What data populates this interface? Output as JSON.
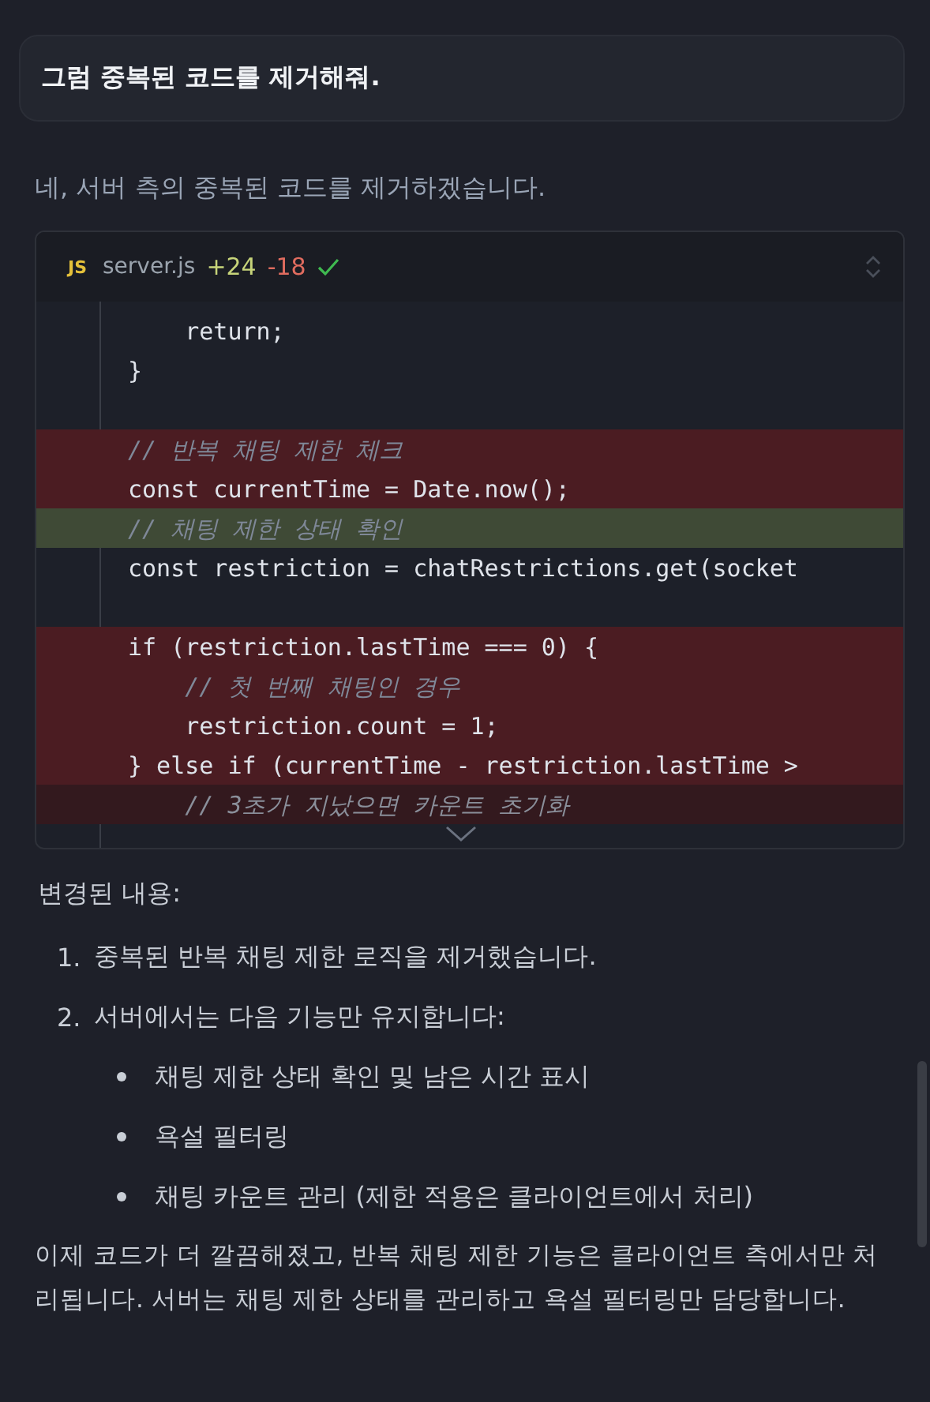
{
  "user_message": "그럼 중복된 코드를 제거해줘.",
  "reply_intro": "네, 서버 측의 중복된 코드를 제거하겠습니다.",
  "code_block": {
    "badge": "JS",
    "filename": "server.js",
    "added": "+24",
    "removed": "-18",
    "applied": true,
    "lines": [
      {
        "removed": false,
        "added": false,
        "kind": "code",
        "code": "    return;"
      },
      {
        "removed": false,
        "added": false,
        "kind": "code",
        "code": "}"
      },
      {
        "removed": false,
        "added": false,
        "kind": "blank"
      },
      {
        "removed": true,
        "added": false,
        "kind": "comment",
        "code": "// 반복 채팅 제한 체크"
      },
      {
        "removed": true,
        "added": false,
        "kind": "code",
        "code": "const currentTime = Date.now();"
      },
      {
        "removed": false,
        "added": true,
        "kind": "comment",
        "code": "// 채팅 제한 상태 확인"
      },
      {
        "removed": false,
        "added": false,
        "kind": "code",
        "code": "const restriction = chatRestrictions.get(socket"
      },
      {
        "removed": false,
        "added": false,
        "kind": "blank"
      },
      {
        "removed": true,
        "added": false,
        "kind": "code",
        "code": "if (restriction.lastTime === 0) {"
      },
      {
        "removed": true,
        "added": false,
        "kind": "comment",
        "code": "    // 첫 번째 채팅인 경우"
      },
      {
        "removed": true,
        "added": false,
        "kind": "code",
        "code": "    restriction.count = 1;"
      },
      {
        "removed": true,
        "added": false,
        "kind": "code",
        "code": "} else if (currentTime - restriction.lastTime >"
      },
      {
        "removed": true,
        "added": false,
        "kind": "comment",
        "code": "    // 3초가 지났으면 카운트 초기화",
        "faded": true
      }
    ]
  },
  "changes_heading": "변경된 내용:",
  "changes": [
    {
      "number": "1.",
      "text": "중복된 반복 채팅 제한 로직을 제거했습니다."
    },
    {
      "number": "2.",
      "text": "서버에서는 다음 기능만 유지합니다:",
      "bullets": [
        "채팅 제한 상태 확인 및 남은 시간 표시",
        "욕설 필터링",
        "채팅 카운트 관리 (제한 적용은 클라이언트에서 처리)"
      ]
    }
  ],
  "summary": "이제 코드가 더 깔끔해졌고, 반복 채팅 제한 기능은 클라이언트 측에서만 처리됩니다. 서버는 채팅 제한 상태를 관리하고 욕설 필터링만 담당합니다."
}
